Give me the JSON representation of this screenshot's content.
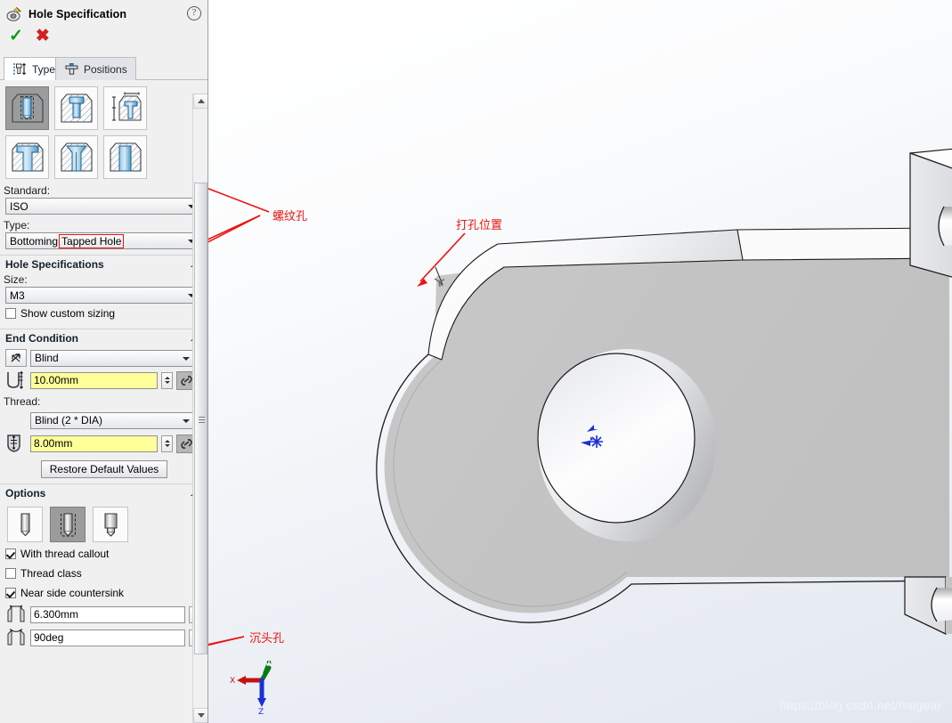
{
  "window": {
    "title": "Hole Specification",
    "title_icon": "hole-wizard-icon",
    "help_icon": "?",
    "ok_icon": "check-mark",
    "cancel_icon": "x-mark"
  },
  "tabs": [
    {
      "label": "Type",
      "icon": "hole-type-icon",
      "active": true
    },
    {
      "label": "Positions",
      "icon": "hole-positions-icon",
      "active": false
    }
  ],
  "hole_types": {
    "row1": [
      {
        "name": "counterbore-hole",
        "selected": true
      },
      {
        "name": "countersink-hole",
        "selected": false
      },
      {
        "name": "hole-dimension",
        "selected": false
      }
    ],
    "row2": [
      {
        "name": "straight-tap",
        "selected": false
      },
      {
        "name": "tapered-tap",
        "selected": false
      },
      {
        "name": "legacy-hole",
        "selected": false
      }
    ]
  },
  "standard": {
    "label": "Standard:",
    "value": "ISO"
  },
  "type": {
    "label": "Type:",
    "value_prefix": "Bottoming",
    "value_highlight": "Tapped Hole"
  },
  "hole_specifications": {
    "title": "Hole Specifications",
    "size_label": "Size:",
    "size_value": "M3",
    "show_custom_sizing": {
      "label": "Show custom sizing",
      "checked": false
    }
  },
  "end_condition": {
    "title": "End Condition",
    "end_condition_value": "Blind",
    "depth_value": "10.00mm",
    "thread_label": "Thread:",
    "thread_value": "Blind (2 * DIA)",
    "thread_depth_value": "8.00mm",
    "restore_button": "Restore Default Values"
  },
  "options": {
    "title": "Options",
    "buttons": [
      {
        "name": "option-cosmetic-thread-none",
        "selected": false
      },
      {
        "name": "option-cosmetic-thread",
        "selected": true
      },
      {
        "name": "option-removed-thread",
        "selected": false
      }
    ],
    "with_thread_callout": {
      "label": "With thread callout",
      "checked": true
    },
    "thread_class": {
      "label": "Thread class",
      "checked": false
    },
    "near_side_countersink": {
      "label": "Near side countersink",
      "checked": true
    },
    "countersink_diameter": "6.300mm",
    "countersink_angle": "90deg"
  },
  "annotations": [
    {
      "name": "annotation-threaded-hole",
      "text": "螺纹孔"
    },
    {
      "name": "annotation-drill-position",
      "text": "打孔位置"
    },
    {
      "name": "annotation-countersink-hole",
      "text": "沉头孔"
    }
  ],
  "axis_triad": {
    "x_label": "X",
    "y_label": "Y",
    "z_label": "Z"
  },
  "watermark": "https://blog.csdn.net/naigear",
  "colors": {
    "annotation_red": "#ef1010",
    "ok_green": "#0a9a18",
    "cancel_red": "#d42020",
    "field_yellow": "#ffff99",
    "panel_bg": "#f0f0f0",
    "model_grey": "#c4c4c4",
    "selected_icon_bg": "#9c9c9c"
  }
}
